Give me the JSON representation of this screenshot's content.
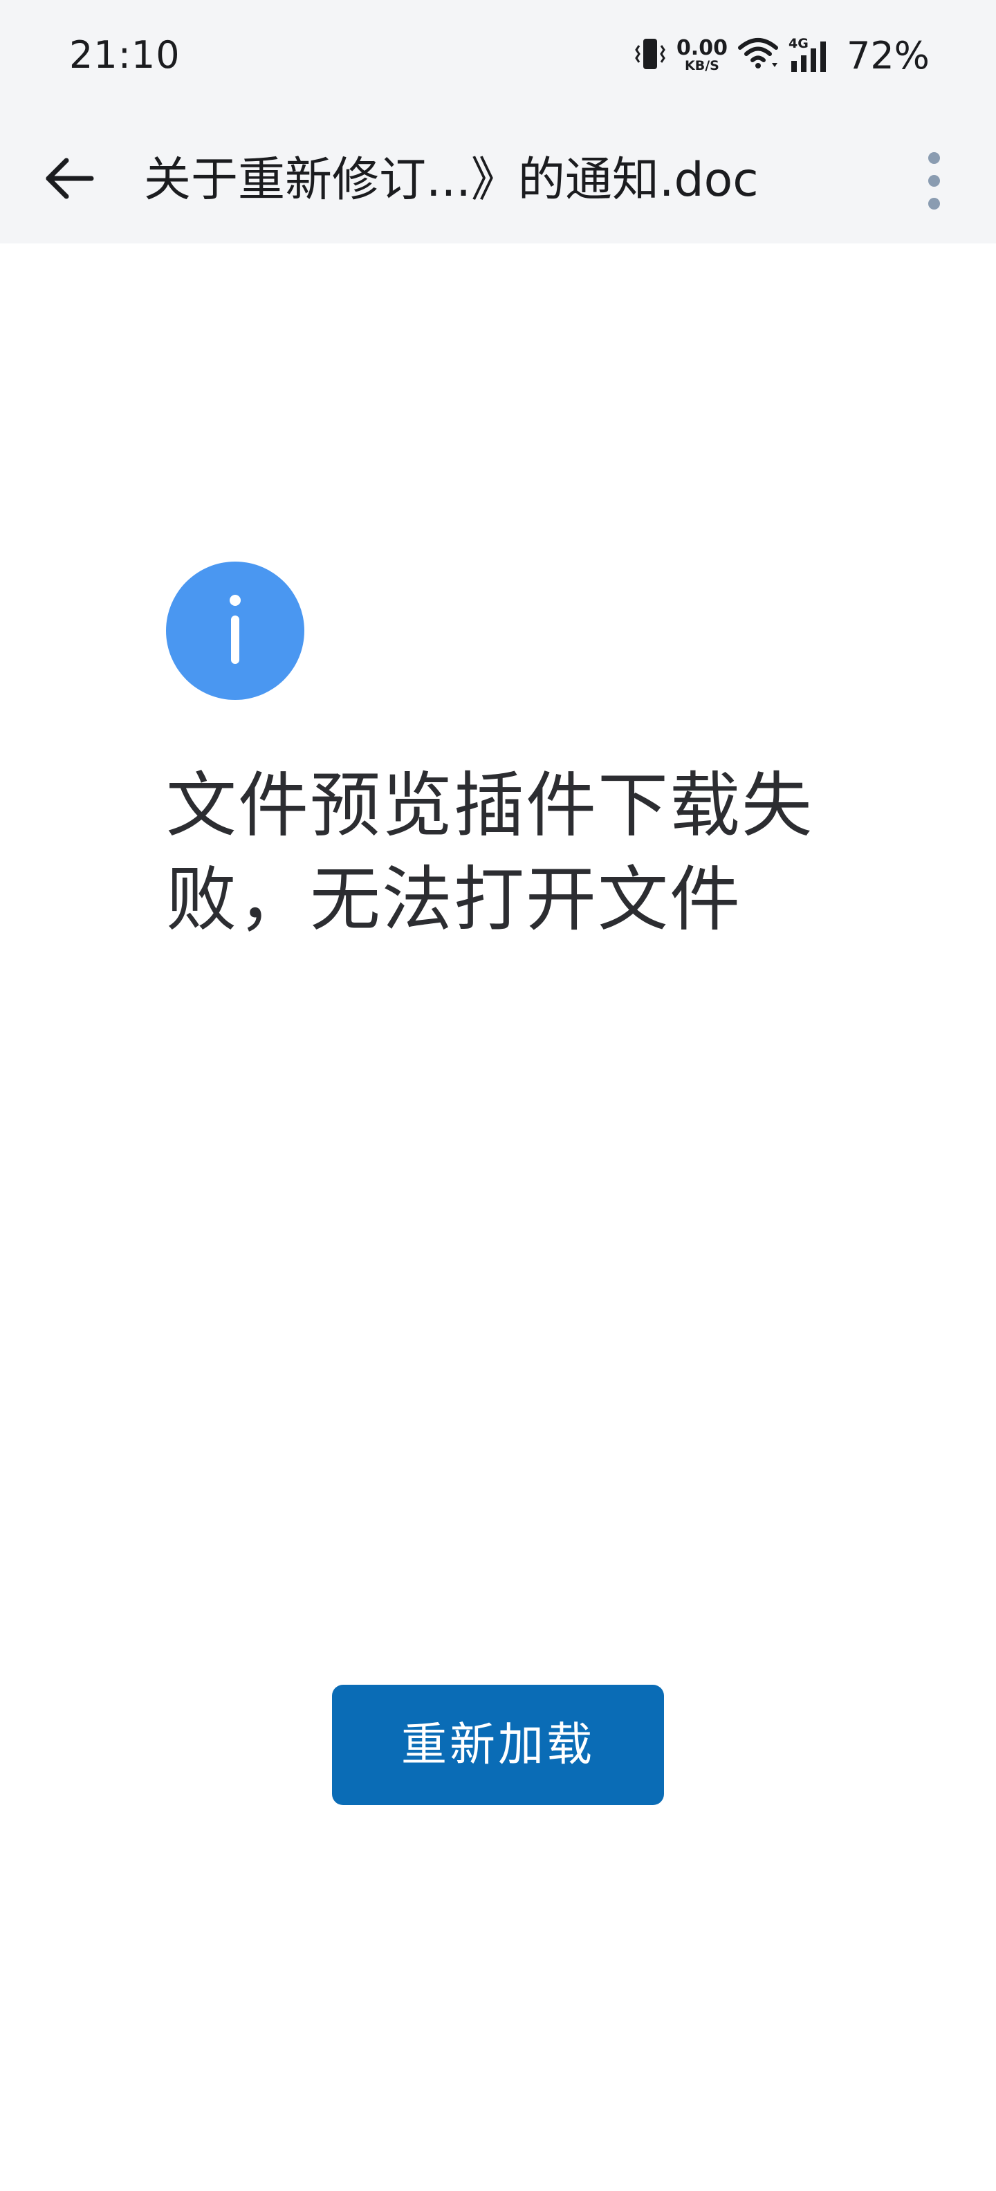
{
  "status_bar": {
    "time": "21:10",
    "network_speed_value": "0.00",
    "network_speed_unit": "KB/S",
    "network_type": "4G",
    "battery": "72%",
    "icons": [
      "vibrate-icon",
      "wifi-icon",
      "cellular-signal-icon"
    ]
  },
  "header": {
    "back_icon": "arrow-left-icon",
    "title": "关于重新修订...》的通知.doc",
    "more_icon": "more-vertical-icon"
  },
  "main": {
    "info_icon": "info-icon",
    "message": "文件预览插件下载失败，无法打开文件",
    "reload_label": "重新加载"
  },
  "colors": {
    "bar_background": "#f4f5f7",
    "info_icon": "#4a97f1",
    "primary_button": "#0a6cb6",
    "text_primary": "#2c2d31",
    "more_dots": "#8a9cb1"
  }
}
